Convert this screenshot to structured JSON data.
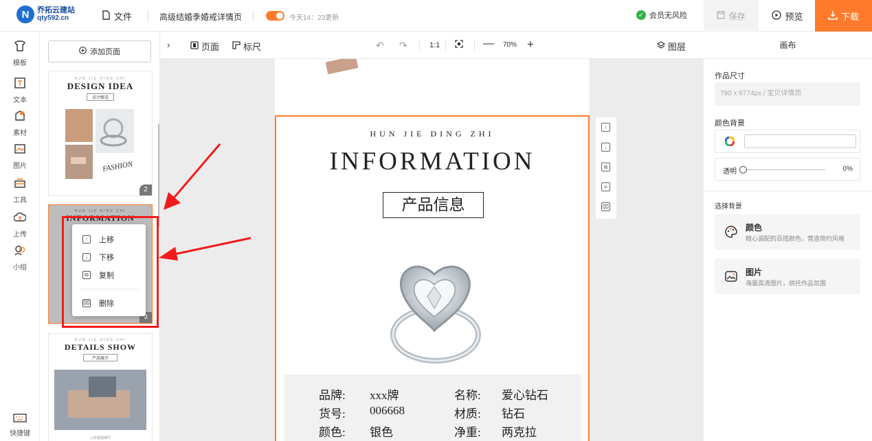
{
  "header": {
    "logo_mark": "N",
    "logo_line1": "乔拓云建站",
    "logo_line2": "qty592.cn",
    "file_label": "文件",
    "doc_title": "高级结婚季婚戒详情页",
    "update_text": "今天14：23更新",
    "safe_label": "会员无风险",
    "save_label": "保存",
    "preview_label": "预览",
    "download_label": "下载"
  },
  "rail": {
    "items": [
      {
        "label": "模板",
        "icon": "template-icon"
      },
      {
        "label": "文本",
        "icon": "text-icon"
      },
      {
        "label": "素材",
        "icon": "material-icon"
      },
      {
        "label": "图片",
        "icon": "image-icon"
      },
      {
        "label": "工具",
        "icon": "toolbox-icon"
      },
      {
        "label": "上传",
        "icon": "upload-icon"
      },
      {
        "label": "小组",
        "icon": "group-icon"
      }
    ],
    "shortcut_label": "快捷键"
  },
  "pages_panel": {
    "add_page_label": "添加页面",
    "thumbs": [
      {
        "small": "HUN JIE DING ZHI",
        "title": "DESIGN IDEA",
        "subtitle": "设计解说",
        "script": "FASHION",
        "num": "2"
      },
      {
        "small": "HUN JIE DING ZHI",
        "title": "INFORMATION",
        "num": "3"
      },
      {
        "small": "HUN JIE DING ZHI",
        "title": "DETAILS SHOW",
        "subtitle": "产品展示",
        "caption": "心形婚戒细节"
      }
    ]
  },
  "context_menu": {
    "items": [
      {
        "label": "上移",
        "icon": "move-up-icon"
      },
      {
        "label": "下移",
        "icon": "move-down-icon"
      },
      {
        "label": "复制",
        "icon": "copy-icon"
      },
      {
        "label": "删除",
        "icon": "delete-icon"
      }
    ]
  },
  "canvas_toolbar": {
    "page_label": "页面",
    "ruler_label": "标尺",
    "ratio_label": "1:1",
    "zoom_label": "70%",
    "layers_label": "图层"
  },
  "page": {
    "small_title": "HUN JIE DING ZHI",
    "big_title": "INFORMATION",
    "box_title": "产品信息",
    "info": [
      {
        "k": "品牌:",
        "v": "xxx牌",
        "k2": "名称:",
        "v2": "爱心钻石"
      },
      {
        "k": "货号:",
        "v": "006668",
        "k2": "材质:",
        "v2": "钻石"
      },
      {
        "k": "颜色:",
        "v": "银色",
        "k2": "净重:",
        "v2": "两克拉"
      }
    ]
  },
  "right_panel": {
    "header": "画布",
    "size_label": "作品尺寸",
    "size_value": "790 x 6774px  / 宝贝详情页",
    "bg_color_label": "颜色背景",
    "opacity_label": "透明",
    "opacity_value": "0%",
    "choose_bg_label": "选择背景",
    "cards": [
      {
        "title": "颜色",
        "desc": "精心调配的百搭颜色，营造简约风格"
      },
      {
        "title": "图片",
        "desc": "海量高清图片，烘托作品氛围"
      }
    ]
  },
  "colors": {
    "accent": "#ff7a2a",
    "brand": "#1f6fd1",
    "annotation": "#f21b1b"
  }
}
